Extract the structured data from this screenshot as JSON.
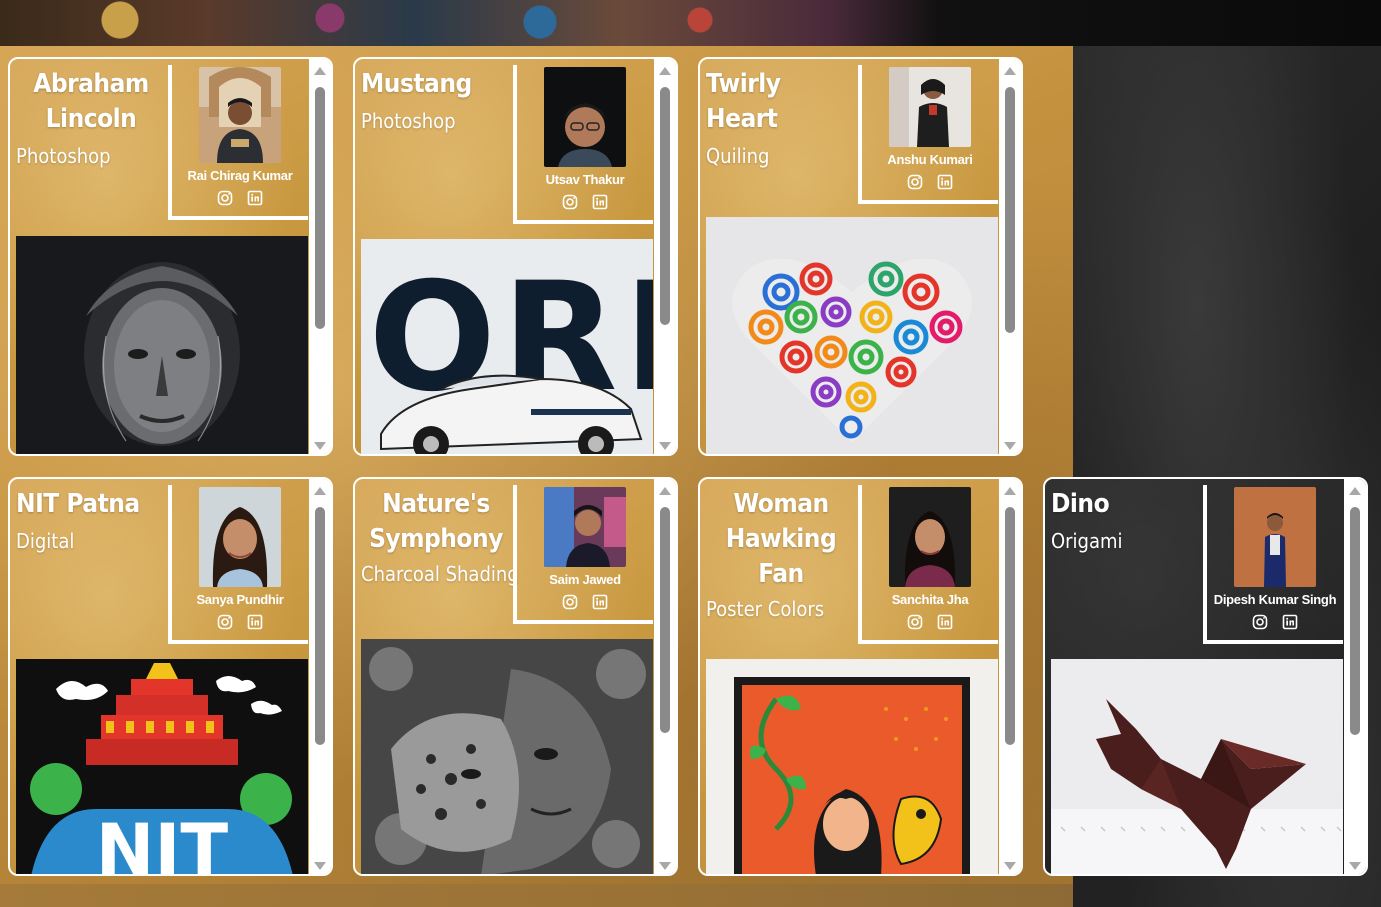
{
  "cards": [
    {
      "title": "Abraham Lincoln",
      "medium": "Photoshop",
      "artist": "Rai Chirag Kumar",
      "instagram_icon": "instagram-icon",
      "linkedin_icon": "linkedin-icon"
    },
    {
      "title": "Mustang",
      "medium": "Photoshop",
      "artist": "Utsav Thakur",
      "instagram_icon": "instagram-icon",
      "linkedin_icon": "linkedin-icon",
      "artwork_text": "FORD"
    },
    {
      "title": "Twirly Heart",
      "medium": "Quiling",
      "artist": "Anshu Kumari",
      "instagram_icon": "instagram-icon",
      "linkedin_icon": "linkedin-icon"
    },
    {
      "title": "NIT Patna",
      "medium": "Digital",
      "artist": "Sanya Pundhir",
      "instagram_icon": "instagram-icon",
      "linkedin_icon": "linkedin-icon",
      "artwork_text": "NIT"
    },
    {
      "title": "Nature's Symphony",
      "medium": "Charcoal Shading",
      "artist": "Saim Jawed",
      "instagram_icon": "instagram-icon",
      "linkedin_icon": "linkedin-icon"
    },
    {
      "title": "Woman Hawking Fan",
      "medium": "Poster Colors",
      "artist": "Sanchita Jha",
      "instagram_icon": "instagram-icon",
      "linkedin_icon": "linkedin-icon"
    },
    {
      "title": "Dino",
      "medium": "Origami",
      "artist": "Dipesh Kumar Singh",
      "instagram_icon": "instagram-icon",
      "linkedin_icon": "linkedin-icon"
    }
  ],
  "background_colors": {
    "gold": "#c8983f",
    "dark": "#262626",
    "border": "#ffffff"
  }
}
